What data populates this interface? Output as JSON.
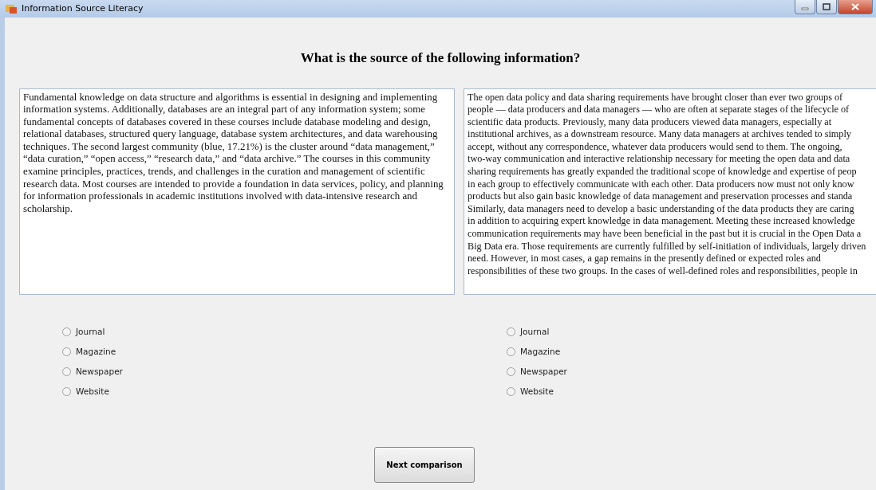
{
  "window": {
    "title": "Information Source Literacy"
  },
  "heading": "What is the source of the following information?",
  "passages": [
    {
      "kind": "paragraph",
      "text": "Fundamental knowledge on data structure and algorithms is essential in designing and implementing information systems. Additionally, databases are an integral part of any information system; some fundamental concepts of databases covered in these courses include database modeling and design, relational databases, structured query language, database system architectures, and data warehousing techniques. The second largest community (blue, 17.21%) is the cluster around “data management,” “data curation,” “open access,” “research data,” and “data archive.” The courses in this community examine principles, practices, trends, and challenges in the curation and management of scientific research data. Most courses are intended to provide a foundation in data services, policy, and planning for information professionals in academic institutions involved with data-intensive research and scholarship.",
      "options": [
        {
          "label": "Journal",
          "selected": false
        },
        {
          "label": "Magazine",
          "selected": false
        },
        {
          "label": "Newspaper",
          "selected": false
        },
        {
          "label": "Website",
          "selected": false
        }
      ]
    },
    {
      "kind": "lines",
      "lines": [
        "The open data policy and data sharing requirements have brought closer than ever two groups of",
        "people — data producers and data managers — who are often at separate stages of the lifecycle of",
        "scientific data products. Previously, many data producers viewed data managers, especially at",
        "institutional archives, as a downstream resource. Many data managers at archives tended to simply",
        "accept, without any correspondence, whatever data producers would send to them. The ongoing,",
        "two-way communication and interactive relationship necessary for meeting the open data and data",
        "sharing requirements has greatly expanded the traditional scope of knowledge and expertise of peop",
        "in each group to effectively communicate with each other. Data producers now must not only know",
        "products but also gain basic knowledge of data management and preservation processes and standa",
        "Similarly, data managers need to develop a basic understanding of the data products they are caring",
        "in addition to acquiring expert knowledge in data management. Meeting these increased knowledge",
        "communication requirements may have been beneficial in the past but it is crucial in the Open Data a",
        "Big Data era. Those requirements are currently fulfilled by self-initiation of individuals, largely driven",
        "need. However, in most cases, a gap remains in the presently defined or expected roles and",
        "responsibilities of these two groups. In the cases of well-defined roles and responsibilities, people in"
      ],
      "options": [
        {
          "label": "Journal",
          "selected": false
        },
        {
          "label": "Magazine",
          "selected": false
        },
        {
          "label": "Newspaper",
          "selected": false
        },
        {
          "label": "Website",
          "selected": false
        }
      ]
    }
  ],
  "button": "Next comparison"
}
